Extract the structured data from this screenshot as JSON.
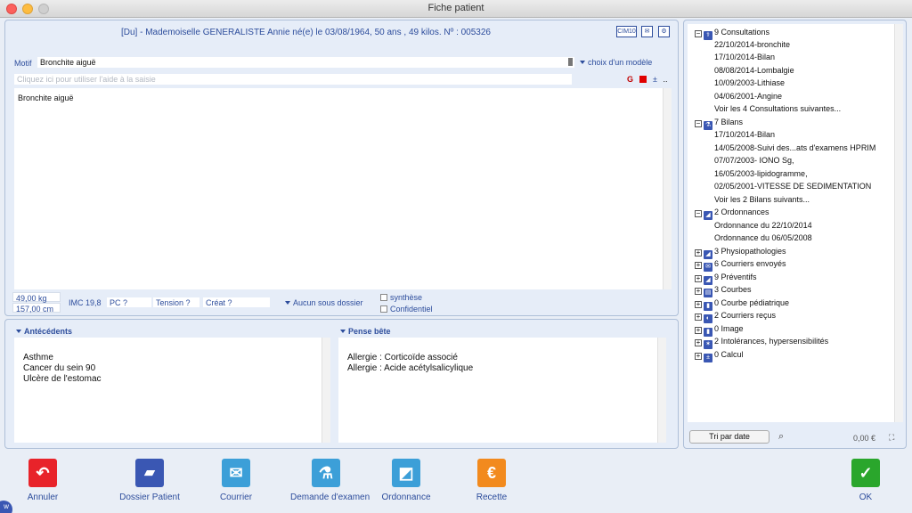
{
  "window": {
    "title": "Fiche patient"
  },
  "header": {
    "patient_line": "[Du] - Mademoiselle GENERALISTE Annie   né(e) le 03/08/1964, 50 ans , 49 kilos.   Nº : 005326",
    "icon_cim": "CIM10"
  },
  "motif": {
    "label": "Motif",
    "value": "Bronchite aiguë",
    "model_choice": "choix d'un modèle",
    "assist_placeholder": "Cliquez ici pour utiliser l'aide à la saisie",
    "format_g": "G",
    "format_plus": "±",
    "format_more": "..",
    "color_red": "#e00000"
  },
  "editor": {
    "text": "Bronchite aiguë"
  },
  "measures": {
    "weight": "49,00 kg",
    "height": "157,00 cm",
    "imc": "IMC 19,8",
    "pc": "PC ?",
    "tension": "Tension ?",
    "creat": "Créat ?",
    "subfolder": "Aucun sous dossier",
    "synthese": "synthèse",
    "confidentiel": "Confidentiel"
  },
  "antecedents": {
    "title": "Antécédents",
    "items": [
      "Asthme",
      "Cancer du sein 90",
      "Ulcère de l'estomac"
    ]
  },
  "pense_bete": {
    "title": "Pense bête",
    "items": [
      "Allergie : Corticoïde associé",
      "Allergie : Acide acétylsalicylique"
    ]
  },
  "tree": {
    "consultations": {
      "label": "9 Consultations",
      "items": [
        "22/10/2014-bronchite",
        "17/10/2014-Bilan",
        "08/08/2014-Lombalgie",
        "10/09/2003-Lithiase",
        "04/06/2001-Angine",
        "Voir les 4 Consultations suivantes..."
      ]
    },
    "bilans": {
      "label": "7 Bilans",
      "items": [
        "17/10/2014-Bilan",
        "14/05/2008-Suivi des...ats d'examens HPRIM",
        "07/07/2003- IONO Sg,",
        "16/05/2003-lipidogramme,",
        "02/05/2001-VITESSE DE SEDIMENTATION",
        "Voir les 2 Bilans suivants..."
      ]
    },
    "ordonnances": {
      "label": "2 Ordonnances",
      "items": [
        "Ordonnance du 22/10/2014",
        "Ordonnance du 06/05/2008"
      ]
    },
    "collapsed": [
      "3 Physiopathologies",
      "6 Courriers envoyés",
      "9 Préventifs",
      "3 Courbes",
      "0 Courbe pédiatrique",
      "2 Courriers reçus",
      "0 Image",
      "2 Intolérances, hypersensibilités",
      "0 Calcul"
    ],
    "sort_button": "Tri par date",
    "amount": "0,00 €"
  },
  "actions": {
    "annuler": "Annuler",
    "dossier": "Dossier Patient",
    "courrier": "Courrier",
    "demande": "Demande d'examen",
    "ordonnance": "Ordonnance",
    "recette": "Recette",
    "ok": "OK"
  },
  "colors": {
    "annuler": "#e8232a",
    "blue_icon": "#3a57b3",
    "cyan_icon": "#3c9fd8",
    "recette": "#f28a1e",
    "ok": "#2aa62c"
  }
}
